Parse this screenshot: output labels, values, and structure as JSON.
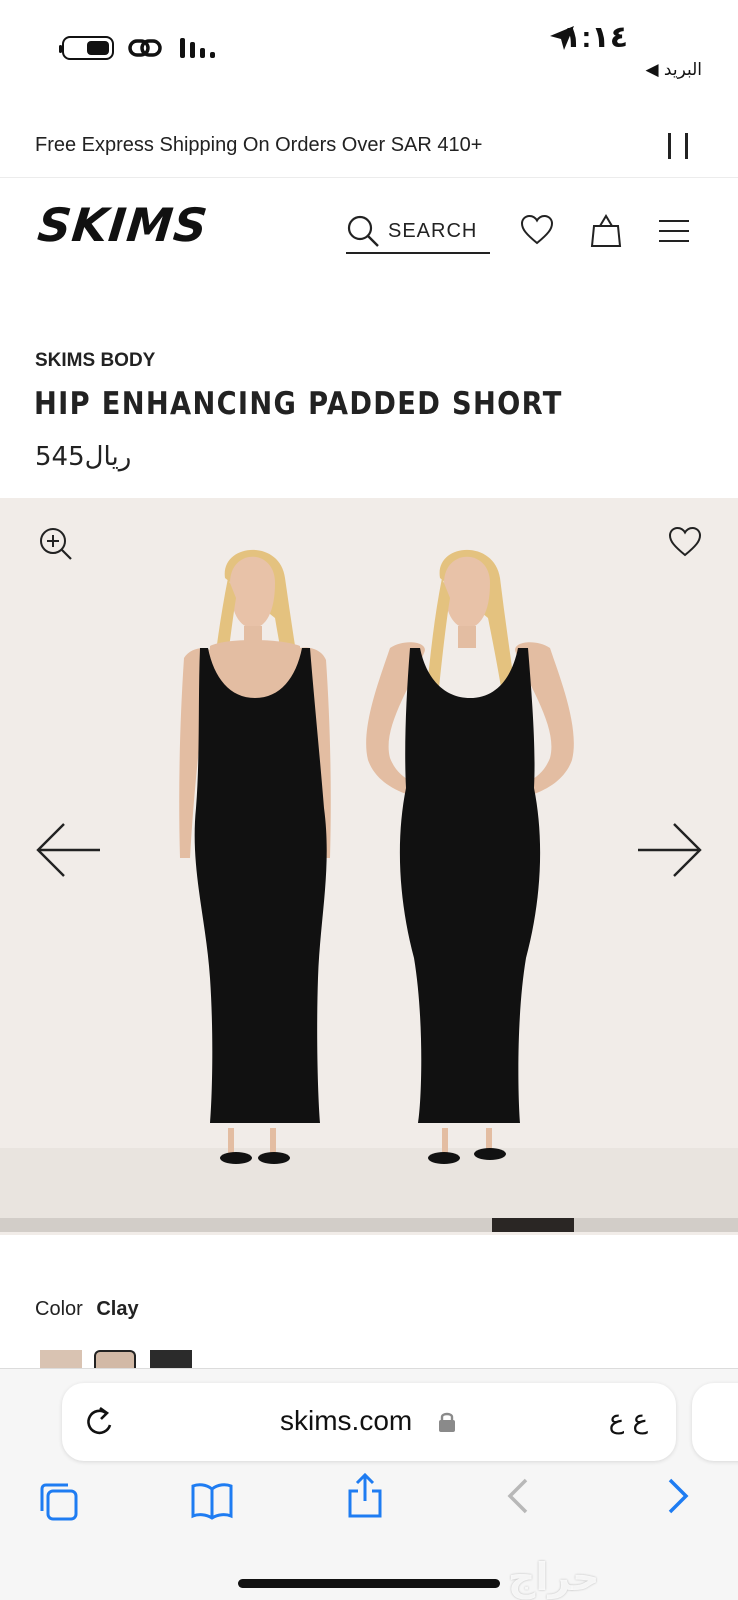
{
  "status_bar": {
    "time": "١:١٤",
    "back_app": "◀ البريد",
    "icons": [
      "battery-icon",
      "link-icon",
      "signal-icon",
      "location-arrow-icon"
    ]
  },
  "promo": {
    "text": "Free Express Shipping On Orders Over SAR 410+",
    "pause_icon": "pause-icon"
  },
  "header": {
    "logo": "SKIMS",
    "search_label": "SEARCH",
    "icons": [
      "search-icon",
      "heart-icon",
      "bag-icon",
      "menu-icon"
    ]
  },
  "product": {
    "brand": "SKIMS BODY",
    "title": "HIP ENHANCING PADDED SHORT",
    "price": "545ريال"
  },
  "gallery": {
    "icons": [
      "zoom-in-icon",
      "wishlist-heart-icon",
      "arrow-left-icon",
      "arrow-right-icon"
    ],
    "current_slide_position": 0.667,
    "background": "#f1ece8"
  },
  "color": {
    "label": "Color",
    "selected": "Clay",
    "swatches": [
      "#d9c3b2",
      "#d2b9a6",
      "#2b2b2b"
    ]
  },
  "browser": {
    "domain": "skims.com",
    "text_size_label": "ع ع",
    "icons": [
      "reload-icon",
      "lock-icon",
      "tabs-icon",
      "bookmarks-icon",
      "share-icon",
      "back-icon",
      "forward-icon"
    ],
    "accent": "#1e7cf2"
  },
  "watermark": "حراج"
}
